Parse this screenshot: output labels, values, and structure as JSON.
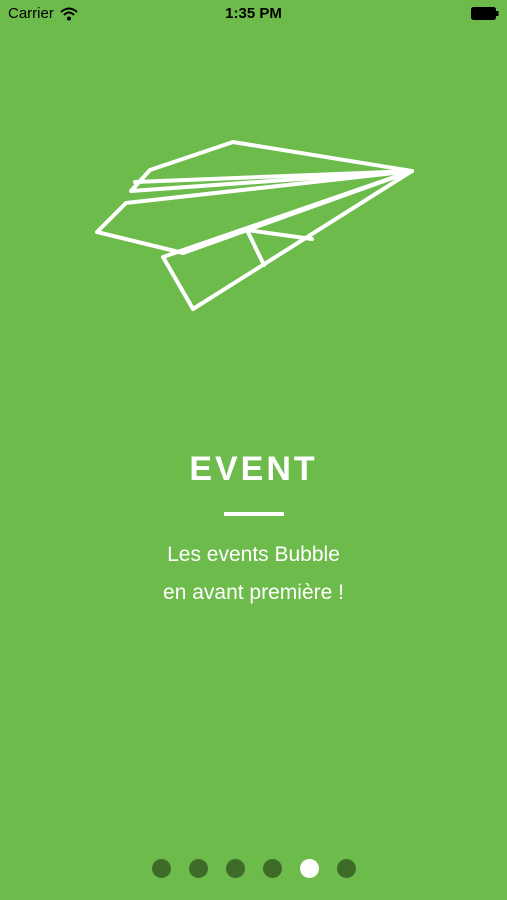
{
  "status_bar": {
    "carrier": "Carrier",
    "time": "1:35 PM"
  },
  "onboarding": {
    "illustration_icon": "paper-plane-icon",
    "title": "EVENT",
    "subtitle_line1": "Les events Bubble",
    "subtitle_line2": "en avant première !"
  },
  "pagination": {
    "total": 6,
    "active_index": 4
  },
  "colors": {
    "background": "#6dbb4b",
    "dot_inactive": "#3f6b28",
    "dot_active": "#ffffff"
  }
}
